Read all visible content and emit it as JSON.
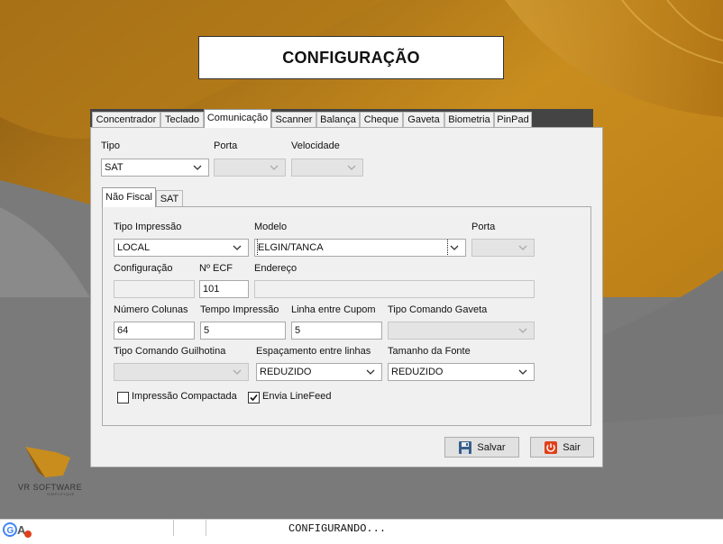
{
  "header": {
    "title": "CONFIGURAÇÃO"
  },
  "tabs": [
    {
      "label": "Concentrador"
    },
    {
      "label": "Teclado"
    },
    {
      "label": "Comunicação"
    },
    {
      "label": "Scanner"
    },
    {
      "label": "Balança"
    },
    {
      "label": "Cheque"
    },
    {
      "label": "Gaveta"
    },
    {
      "label": "Biometria"
    },
    {
      "label": "PinPad"
    }
  ],
  "comunicacao": {
    "tipo_label": "Tipo",
    "tipo_value": "SAT",
    "porta_label": "Porta",
    "velocidade_label": "Velocidade"
  },
  "subtabs": [
    {
      "label": "Não Fiscal"
    },
    {
      "label": "SAT"
    }
  ],
  "nao_fiscal": {
    "tipo_impressao_label": "Tipo Impressão",
    "tipo_impressao_value": "LOCAL",
    "modelo_label": "Modelo",
    "modelo_value": "ELGIN/TANCA",
    "porta_label": "Porta",
    "configuracao_label": "Configuração",
    "num_ecf_label": "Nº ECF",
    "num_ecf_value": "101",
    "endereco_label": "Endereço",
    "numero_colunas_label": "Número Colunas",
    "numero_colunas_value": "64",
    "tempo_impressao_label": "Tempo Impressão",
    "tempo_impressao_value": "5",
    "linha_entre_cupom_label": "Linha entre Cupom",
    "linha_entre_cupom_value": "5",
    "tipo_comando_gaveta_label": "Tipo Comando Gaveta",
    "tipo_comando_guilhotina_label": "Tipo Comando Guilhotina",
    "espacamento_label": "Espaçamento entre linhas",
    "espacamento_value": "REDUZIDO",
    "tamanho_fonte_label": "Tamanho da Fonte",
    "tamanho_fonte_value": "REDUZIDO",
    "impressao_compactada_label": "Impressão Compactada",
    "impressao_compactada_checked": false,
    "envia_linefeed_label": "Envia LineFeed",
    "envia_linefeed_checked": true
  },
  "buttons": {
    "salvar": "Salvar",
    "sair": "Sair"
  },
  "logo": {
    "name": "VR SOFTWARE",
    "tagline": "SIMPLIFIQUE"
  },
  "statusbar": {
    "text": "CONFIGURANDO..."
  },
  "colors": {
    "background_gold": "#c98d1e",
    "background_gray": "#7a7a7a",
    "sair_icon": "#e0401a",
    "salvar_icon": "#3a5f8a"
  }
}
